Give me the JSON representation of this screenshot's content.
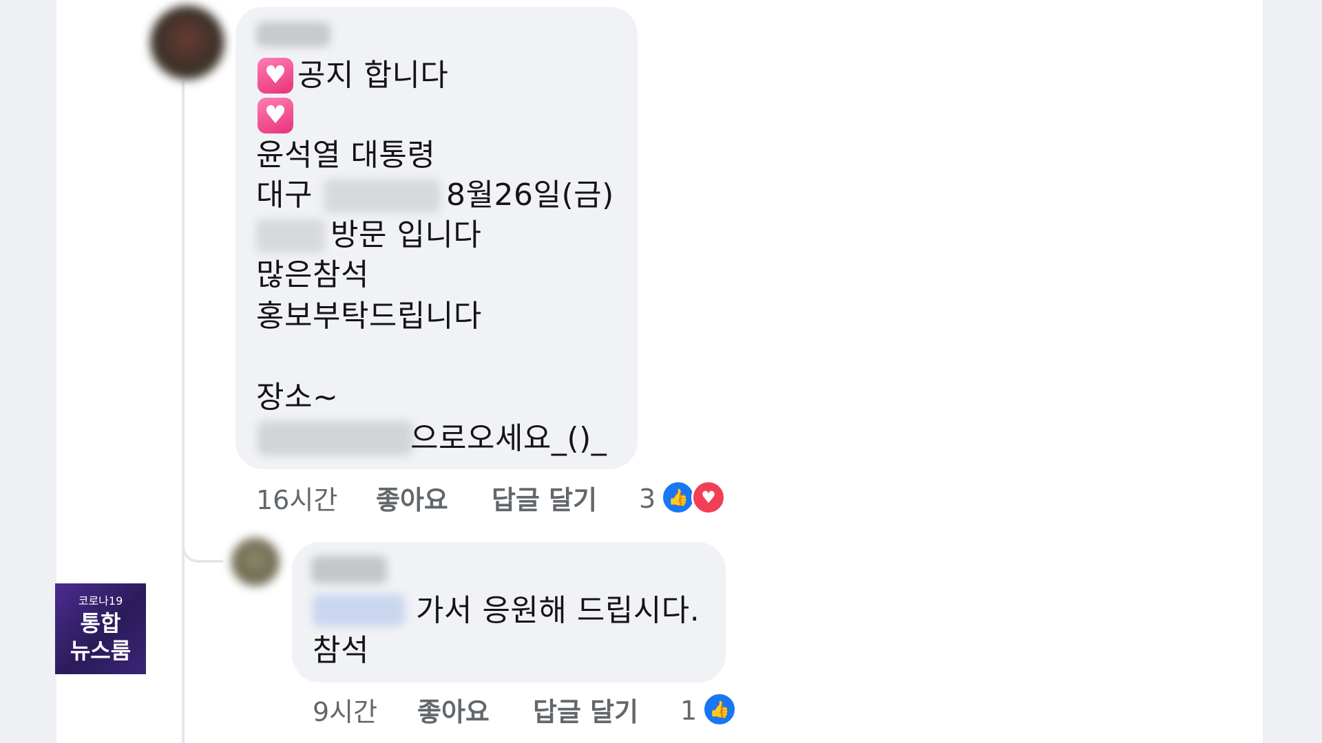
{
  "colors": {
    "page_bg": "#eef0f3",
    "panel_bg": "#ffffff",
    "bubble_bg": "#f0f2f5",
    "meta_text": "#62676b",
    "like_blue": "#1877f2",
    "love_red": "#f33e58",
    "logo_purple": "#4b2c8e"
  },
  "comment1": {
    "lines": [
      "공지 합니다",
      "윤석열 대통령",
      "대구",
      "8월26일(금)",
      "방문 입니다",
      "많은참석",
      "홍보부탁드립니다",
      "장소~",
      "으로오세요_()_"
    ],
    "time": "16시간",
    "like_label": "좋아요",
    "reply_label": "답글 달기",
    "reaction_count": "3",
    "reaction_icons": [
      "like-icon",
      "love-icon"
    ]
  },
  "comment2": {
    "line1": "가서 응원해 드립시다.",
    "line2": "참석",
    "time": "9시간",
    "like_label": "좋아요",
    "reply_label": "답글 달기",
    "reaction_count": "1",
    "reaction_icons": [
      "like-icon"
    ]
  },
  "news_logo": {
    "sub": "코로나19",
    "line1": "통합",
    "line2": "뉴스룸"
  }
}
